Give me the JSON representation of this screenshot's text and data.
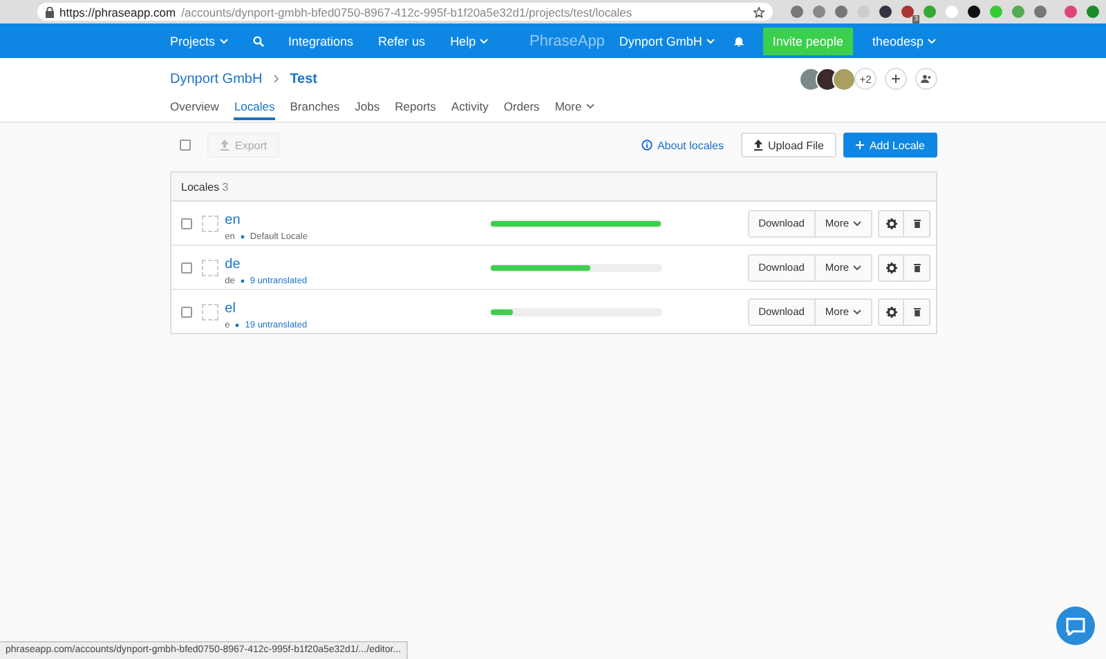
{
  "browser": {
    "url_host": "https://phraseapp.com",
    "url_path": "/accounts/dynport-gmbh-bfed0750-8967-412c-995f-b1f20a5e32d1/projects/test/locales",
    "badge": "3"
  },
  "nav": {
    "items": [
      {
        "label": "Projects",
        "dropdown": true
      },
      {
        "label": "Integrations",
        "dropdown": false
      },
      {
        "label": "Refer us",
        "dropdown": false
      },
      {
        "label": "Help",
        "dropdown": true
      }
    ],
    "brand": "PhraseApp",
    "account": "Dynport GmbH",
    "invite": "Invite people",
    "user": "theodesp"
  },
  "breadcrumb": [
    "Dynport GmbH",
    "Test"
  ],
  "members": {
    "more": "+2"
  },
  "tabs": [
    {
      "label": "Overview",
      "selected": false
    },
    {
      "label": "Locales",
      "selected": true
    },
    {
      "label": "Branches",
      "selected": false
    },
    {
      "label": "Jobs",
      "selected": false
    },
    {
      "label": "Reports",
      "selected": false
    },
    {
      "label": "Activity",
      "selected": false
    },
    {
      "label": "Orders",
      "selected": false
    },
    {
      "label": "More",
      "selected": false
    }
  ],
  "toolbar": {
    "select_all_checked": false,
    "export": "Export",
    "export_disabled": true,
    "about": "About locales",
    "upload": "Upload File",
    "add": "Add Locale"
  },
  "table": {
    "title": "Locales",
    "count": "3",
    "rows": [
      {
        "checked": false,
        "name": "en",
        "code": "en",
        "note": "Default Locale",
        "note_is_link": false,
        "level": 1.0,
        "download": "Download",
        "more": "More"
      },
      {
        "checked": false,
        "name": "de",
        "code": "de",
        "note": "9 untranslated",
        "note_is_link": true,
        "level": 0.59,
        "download": "Download",
        "more": "More"
      },
      {
        "checked": false,
        "name": "el",
        "code": "e",
        "note": "19 untranslated",
        "note_is_link": true,
        "level": 0.13,
        "download": "Download",
        "more": "More"
      }
    ]
  },
  "status_bar": "phraseapp.com/accounts/dynport-gmbh-bfed0750-8967-412c-995f-b1f20a5e32d1/.../editor..."
}
